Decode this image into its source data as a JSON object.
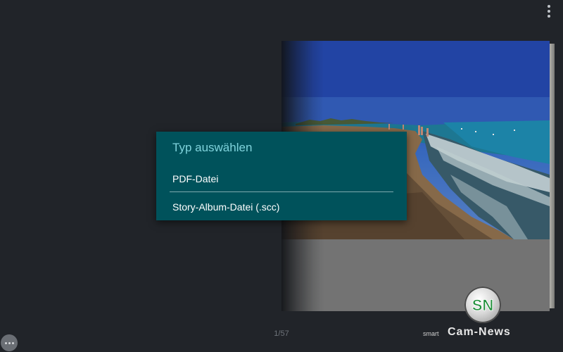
{
  "header": {
    "overflow_menu_icon": "more-vert-icon"
  },
  "dialog": {
    "title": "Typ auswählen",
    "options": [
      {
        "label": "PDF-Datei"
      },
      {
        "label": "Story-Album-Datei (.scc)"
      }
    ],
    "background": "#00525b",
    "title_color": "#7fd3dc"
  },
  "footer": {
    "page_counter": "1/57",
    "more_icon": "more-horiz-icon"
  },
  "watermark": {
    "logo_text": "SN",
    "prefix": "smart",
    "brand": "Cam-News"
  },
  "colors": {
    "background": "#212429"
  }
}
